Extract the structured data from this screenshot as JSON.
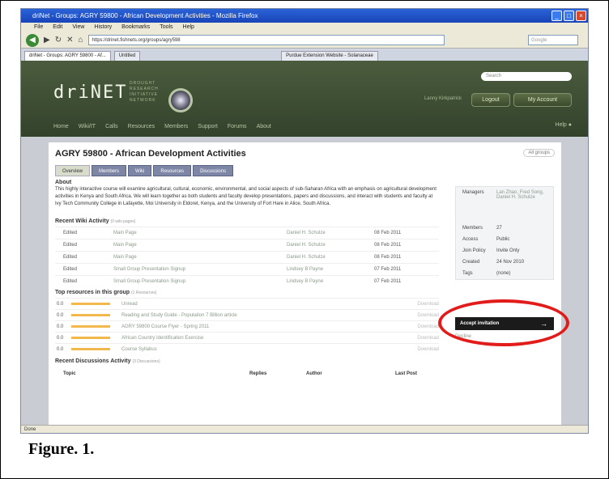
{
  "window": {
    "title": "driNet - Groups: AGRY 59800 - African Development Activities - Mozilla Firefox",
    "buttons": [
      "_",
      "□",
      "×"
    ]
  },
  "menu": [
    "File",
    "Edit",
    "View",
    "History",
    "Bookmarks",
    "Tools",
    "Help"
  ],
  "address": {
    "url": "https://drinet.fishnets.org/groups/agry598",
    "search_placeholder": "Google"
  },
  "tabs": [
    "driNet - Groups: AGRY 59800 - Af...",
    "Untitled",
    "Purdue Extension Website - Solanaceae"
  ],
  "site": {
    "logo": "driNET",
    "tagline": [
      "DROUGHT",
      "RESEARCH",
      "INITIATIVE",
      "NETWORK"
    ],
    "search_placeholder": "Search",
    "user_link": "Lanny Kirkpatrick",
    "logout": "Logout",
    "my_account": "My Account",
    "nav": [
      "Home",
      "Wiki/IT",
      "Calls",
      "Resources",
      "Members",
      "Support",
      "Forums",
      "About"
    ],
    "help": "Help"
  },
  "group": {
    "title": "AGRY 59800 - African Development Activities",
    "all_groups": "All groups",
    "tabs": [
      "Overview",
      "Members",
      "Wiki",
      "Resources",
      "Discussions"
    ],
    "about_heading": "About",
    "about_text": "This highly interactive course will examine agricultural, cultural, economic, environmental, and social aspects of sub-Saharan Africa with an emphasis on agricultural development activities in Kenya and South Africa. We will learn together as both students and faculty develop presentations, papers and discussions, and interact with students and faculty at Ivy Tech Community College in Lafayette, Moi University in Eldoret, Kenya, and the University of Fort Hare in Alice, South Africa.",
    "wiki_heading": "Recent Wiki Activity",
    "wiki_heading_note": "(0 wiki pages)",
    "wiki_rows": [
      {
        "action": "Edited",
        "page": "Main Page",
        "author": "Daniel H. Schulze",
        "date": "08 Feb 2011"
      },
      {
        "action": "Edited",
        "page": "Main Page",
        "author": "Daniel H. Schulze",
        "date": "08 Feb 2011"
      },
      {
        "action": "Edited",
        "page": "Main Page",
        "author": "Daniel H. Schulze",
        "date": "08 Feb 2011"
      },
      {
        "action": "Edited",
        "page": "Small Group Presentation Signup",
        "author": "Lindsey B Payne",
        "date": "07 Feb 2011"
      },
      {
        "action": "Edited",
        "page": "Small Group Presentation Signup",
        "author": "Lindsey B Payne",
        "date": "07 Feb 2011"
      }
    ],
    "resources_heading": "Top resources in this group",
    "resources_note": "(1 Resources)",
    "resources": [
      {
        "score": "0.0",
        "title": "Unread",
        "action": "Download"
      },
      {
        "score": "0.0",
        "title": "Reading and Study Guide - Population 7 Billion article",
        "action": "Download"
      },
      {
        "score": "0.0",
        "title": "AGRY 59800 Course Flyer - Spring 2011",
        "action": "Download"
      },
      {
        "score": "0.0",
        "title": "African Country Identification Exercise",
        "action": "Download"
      },
      {
        "score": "0.0",
        "title": "Course Syllabus",
        "action": "Download"
      }
    ],
    "discussion_heading": "Recent Discussions Activity",
    "discussion_note": "(3 Discussions)",
    "discussion_columns": [
      "Topic",
      "Replies",
      "Author",
      "Last Post"
    ]
  },
  "sidebar": {
    "props": [
      {
        "label": "Managers",
        "value": "Lan Zhao, Fred Song, Daniel H. Schulze"
      },
      {
        "label": "Members",
        "value": "27"
      },
      {
        "label": "Access",
        "value": "Public"
      },
      {
        "label": "Join Policy",
        "value": "Invite Only"
      },
      {
        "label": "Created",
        "value": "24 Nov 2010"
      },
      {
        "label": "Tags",
        "value": "(none)"
      }
    ],
    "accept_label": "Accept invitation",
    "accept_arrow": "→",
    "decline_label": "Decline"
  },
  "status_text": "Done",
  "caption": "Figure. 1.",
  "colors": {
    "highlight_ellipse": "#e21b1b",
    "header_bg": "#3b4a2f",
    "tab_bg": "#7e86a5"
  }
}
